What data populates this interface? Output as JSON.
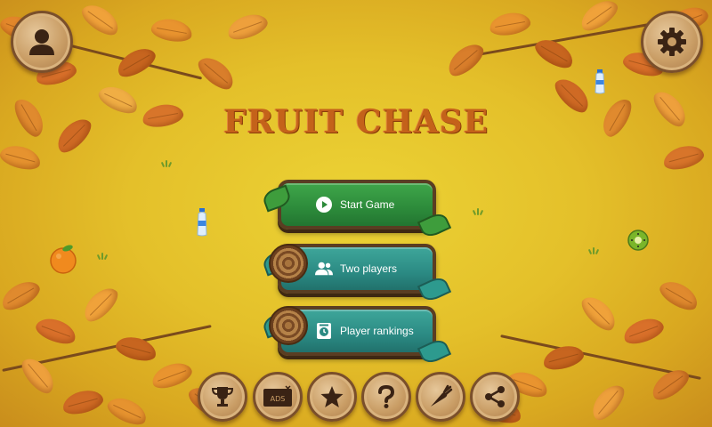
{
  "title": "FRUIT CHASE",
  "menu": {
    "start_label": "Start Game",
    "two_players_label": "Two players",
    "rankings_label": "Player rankings"
  },
  "icons": {
    "profile": "person-icon",
    "settings": "gear-icon",
    "trophy": "trophy-icon",
    "ads": "no-ads-icon",
    "star": "star-icon",
    "help": "question-icon",
    "carrot": "carrot-icon",
    "share": "share-icon"
  },
  "ads_text": "ADS",
  "colors": {
    "background": "#e4c02a",
    "title": "#c4621a",
    "button_green": "#2c8a3a",
    "button_teal": "#2b8a83",
    "wood": "#c99d65"
  }
}
